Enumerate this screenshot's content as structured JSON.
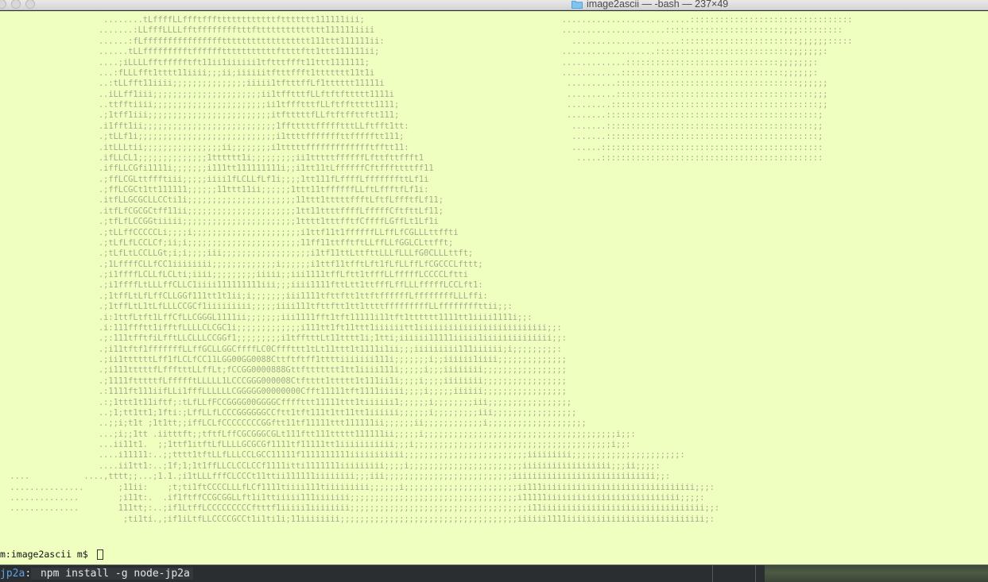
{
  "window": {
    "title": "image2ascii — -bash — 237×49",
    "folder_icon": "folder-icon"
  },
  "terminal": {
    "background": "#efffc0",
    "ascii_rows": [
      "                     ........tLffffLLffftfffttttttttttttfttttttt111111iii;                                        ..........................:::::::::::::::::::::::::::::::::",
      "                    .......:LLfffLLLLfftfffffffftttftttttttttttttt111111iiii                                      .....................::::::::::::::::::::::::;;;:::::::::",
      "                    ......:fLfffffffffffffffftttttttttttttttttt111ttt111111ii:                                      ......................::::::::::::::::::::::::;;;;;;:::::",
      "                    ......tLLffffffffftfffffftttttttttttfttttftt1ttt111111ii;                                     ...................:::::::::::::::::::::::::::;;;;;;;:",
      "                    ....;iLLLLfftffffftft11ii1iiiiii1tftttffft11ttt1111111;                                       .............:::::::::::::::::::::::::::::::;;;;;;;:",
      "                    ...:fLLLfft1tttt11iiii;;;ii;iiiiiitftttffft1ttttttt11t1i                                      ............:::::::::::::::::::::::::::::::::;;;;;;:",
      "                    ..:tLLfft11iiii;;;;;;;;;;;;;;;iiiii1tftttffLf1tttttt11111i                                     ..........:::::::::::::::::::::::::::::::::::::;;;;;;",
      "                    ..iLLff1iii;;;;;;;;;;;;;;;;;;;;;;ii1tfftttfLLftftfttttt1111i                                   ..........::::::::::::::::::::::::::::::::::::::::;;;",
      "                    ..ttfftiiii;;;;;;;;;;;;;;;;;;;;;;;ii1tffftttfLLftffttttt1111;                                  .........::::::::::::::::::::::::::::::::::::::::::;;",
      "                    .;1tff1iii;;;;;;;;;;;;;;;;;;;;;;;;;itftttttfLLftftffttftt111;                                  ........:::::::::::::::::::::::::::::::::::::::::::;",
      "                    .i1fft1ii;;;;;;;;;;;;;;;;;;;;;;;;;;;1fftttttffffftttLLftfft1tt:                                 .......::::::::::::::::::::::::::::::::::::::::::;;",
      "                    .;tLLf1i;;;;;;;;;;;;;;;;;;;;;;;;;;;;i1ttttfffffffttffffftt111;                                  .......:::::::::::::::::::::::::::::::::::::::::::;",
      "                    .itLLLtii;;;;;;;;;;;;;;;;ii;;;;;;;;i1tttttffffffffffffftfftt11:                                 ......:::::::::::::::::::::::::::::::::::::::::::::",
      "                    .ifLLCL1;;;;;;;;;;;;;;1tttttt1i;;;;;;;;;ii1tttttffffffLfttfttffft1                               .....:::::::::::::::::::::::::::::::::::::::::::::",
      "                    .iffLLCGfi1111i;;;;;;;i111tt111111111i;;i1tt11tLffffffCftfffttttff11",
      "                    .;ffLCGLttffftiii;;;;;iiii1fLCLLfLf1i;;;;1tt111fLffffLfffffffttLf1i",
      "                    .;ffLCGCt1tt111111;;;;;;11ttt11ii;;;;;;1ttt11tffffffLLftLffftfLf1i:",
      "                    .itfLLGCGCLLCCti1i;;;;;;;;;;;;;;;;;;;;;;11ttt1tttttffftLftfLffftfLf11;",
      "                    .itfLfCGCGCtff11ii;;;;;;;;;;;;;;;;;;;;;;1tt11ttttffffLfffffCftfttLf11;",
      "                    .;tfLfLCCGGtiiiii;;;;;;;;;;;;;;;;;;;;;;;1tttt1tttfftfCffffLGffLt1Lf1i",
      "                    .;tLLffCCCCCLi;;;;i;;;;;;;;;;;;;;;;;;;;;;i1ttf11t1ffffffLLffLfCGLLLttffti",
      "                    .;tLfLfLCCLCf;ii;i;;;;;;;;;;;;;;;;;;;;;;;11ff11ttfftftLLffLLfGGLCLttfft;",
      "                    .;tLfLtLCCLLGt;i;i;;;;iii;;;;;;;;;;;;;;;;;;i1tf11ttLttfttLLLfLLLfG0CLLLttft;",
      "                    .;1LffffCLLfCC1iiiiiiii;;;;;;;;;;;;;i;;;;;;i1ttf11tfftLft1fLfLLffLfCGCCCLfttt;",
      "                    .;i1ffffLCLLfLCLti;iiii;;;;;;;;;iiiii;;iii1111tffLftt1tfffLLfffffLCCCCLftti",
      "                    .;i1ffffLtLLLffCLLC1iiii111111111iii;;;iiii1111fttLtt1ttfffLffLLLfffffLCCLft1:",
      "                    .;1tffLtLfLffCLLGGf111tt1t1ii;i;;;;;;;iii1111tfttftt1ttftffffffLffffffffLLLffi:",
      "                    .;1tffLtL1tLfLLLCCGCf1iiiiiiiii;;;;;iiii111tfttftt1tt1ttttfffffffffLLffffffffttii;;:",
      "                    .i:1ttfLtft1LffCfLLCGGGL1111ii;;;;;;;iii1111fft1tft11111i11tft1tttttt1111tt1iiii1111i;;:",
      "                    .i:111ffftt1ifftfLLLLCLCGC1i;;;;;;;;;;;;;i111tt1ft11ttt1iiiiiitt1iiiiiiiiiiiiiiiiiiiiiiiiii;;:",
      "                    .;:111tfftfiLfftLLCLLLCCGGf1;;;;;;;;;i1tfftttLt11tttt1i;1tti;iiiiii11111iiiii1iiiiiiiiiiiiii;;:",
      "                    .;i11tftf1fffffffLLffGCLLGGCffffLC0Cfffttt1tLt11ttt1t1111i1ii;;;iiiiiiiii111iiiiii;i;;;;;;;;;:",
      "                    .;ii1ttttttLff1fLCLfCC11LGG00GG0088Cttftftff1ttttiiiiiii111i;;;;;;;i;;iiiiii1iiii;;;;;;;;;;;;;;",
      "                    .;i111tttttfLffftttLLffLt;fCCGG0000888Gttfttttttt1tt1iiii111i;;;;;i;;;iiiiiiii;;;;;;;;;;;;;;;;;",
      "                    .;1111ftttttfLffffftLLLLL1LCCCGGG000008Ctftttt1ttttt1t111ii1i;;;;i;;;;iiiiiiii;;;;;;;;;;;;;;;;;",
      "                    .:1111ft111iifLLi1fffLLLLLLCGGGGG00000000Cfft11111tft1111iiiii;;;;i;;;;;iiiiii;;;;;;;;;;;;;;;;;",
      "                    .:;1ttt1t11iftf;:tLfLLfFCCGGGG00GGGGCffffttt11111ttt1tiiiiii1;;;;;;i;;;;;;;;iii;;;;;;;;;;;;;;;;;",
      "                    ..;1;tt1tt1;1fti:;LffLLfLCCCGGGGGGCCftt1tft111t1tt11tt1iiiiii;;;;;;i;;;;;;;;;iii;;;;;;;;;;;;;;;;;",
      "                    ..;;i;t1t ;1t1tt;;iffLCLfCCCCCCCCGGftt11tf11111ttt111111ii;;;;;;ii;;;;;;;;;;;;i;;;;;;;;;;;;;;;;;;;;",
      "                    ...;i;;1tt .iitttft;;tftfLffCGCGGGCGLt111ftt111ttttt111111ii;;;;;i;;;;;;;;;;;;;;;;;;;;;;;;;;;;;;;;;;;;;;;i;;:",
      "                    ...ii11t1.  ;;1ttf1itftLfLLLLGCGCGf1111tf11111tt1iiiiiiiiiii;;;i;;;;;;;;;;;;;;;;;;;;;;;;;;;;;;;;;;;;;;;;i;;:",
      "                    ....i11111:..;;tttt1tftLLfLLLCCLGCC11111f1111111111iiiiiiiiiii;;;;;;;;;;;;;;;;;;;;;;;;;iiiiiiiii;;;;;;;;;;;;;;;;;;;;;;:",
      "                    ....ii1tt1:..;1f;1;1t1ffLLCLCCLCCf1111itti1111111iiiiiiiii;;;;i;;;;;;;;;;;;;;;;;;;;;;;iiiiiiiiiiiiiiiiii;;;ii;;;;:",
      "  ....           ....,tttt;;...;1.1.;i1tLLLfffCLCCCt11ttii111111iiiiiiii;;;iii;;;;;;;;;;;;;;;;;;;;;;;;;;iiiiiiiiiiiiiiiiiiiiiiiiiiiii;;:",
      "  ...............       ;11ii:    ;t;ti1ftCCCCLLLfLCf1111tiiii111tiiiiiiiii;;;;;;i;;;;;;;;;;;;;;;;;;;;;;;ii111iiiiiiiiiiiiiiiiiiiiiiiiiiiiiii;;;:",
      "  ..............        ;i11t:.  .if1ftffCCGCGGLLft1i1ttiiiii111iiiiiii;;;;;;;;;;;;;;;;;;;;;;;;;;;;;;;;;;i11111iiiiiiiiiiiiiiiiiiiiiiiiiii;;;;:",
      "  ..............        111tt;:..;if1LtffLCCCCCCCCCftttf1iiiii1iiiiiiii;;;;;;;;;;;;;;;;;;;;;;;;;;;;;;;;;;;;i11iiiiiiiiiiiiiiiiiiiiiiiiiiiiiiiii;;:",
      "                         ;ti1ti.,;if1iLtfLLCCCCGCCt1i1ti1i;11iiiiiiii;;;;;;;;;;;;;;;;;;;;;;;;;;;;;;;;;;;;iiiiii1111iiiiiiiiiiiiiiiiiiiiiiiiiiii;:"
    ],
    "prompt": "m:image2ascii m$ "
  },
  "background_window": {
    "package": "jp2a",
    "separator": ":",
    "command": " npm install -g node-jp2a"
  }
}
